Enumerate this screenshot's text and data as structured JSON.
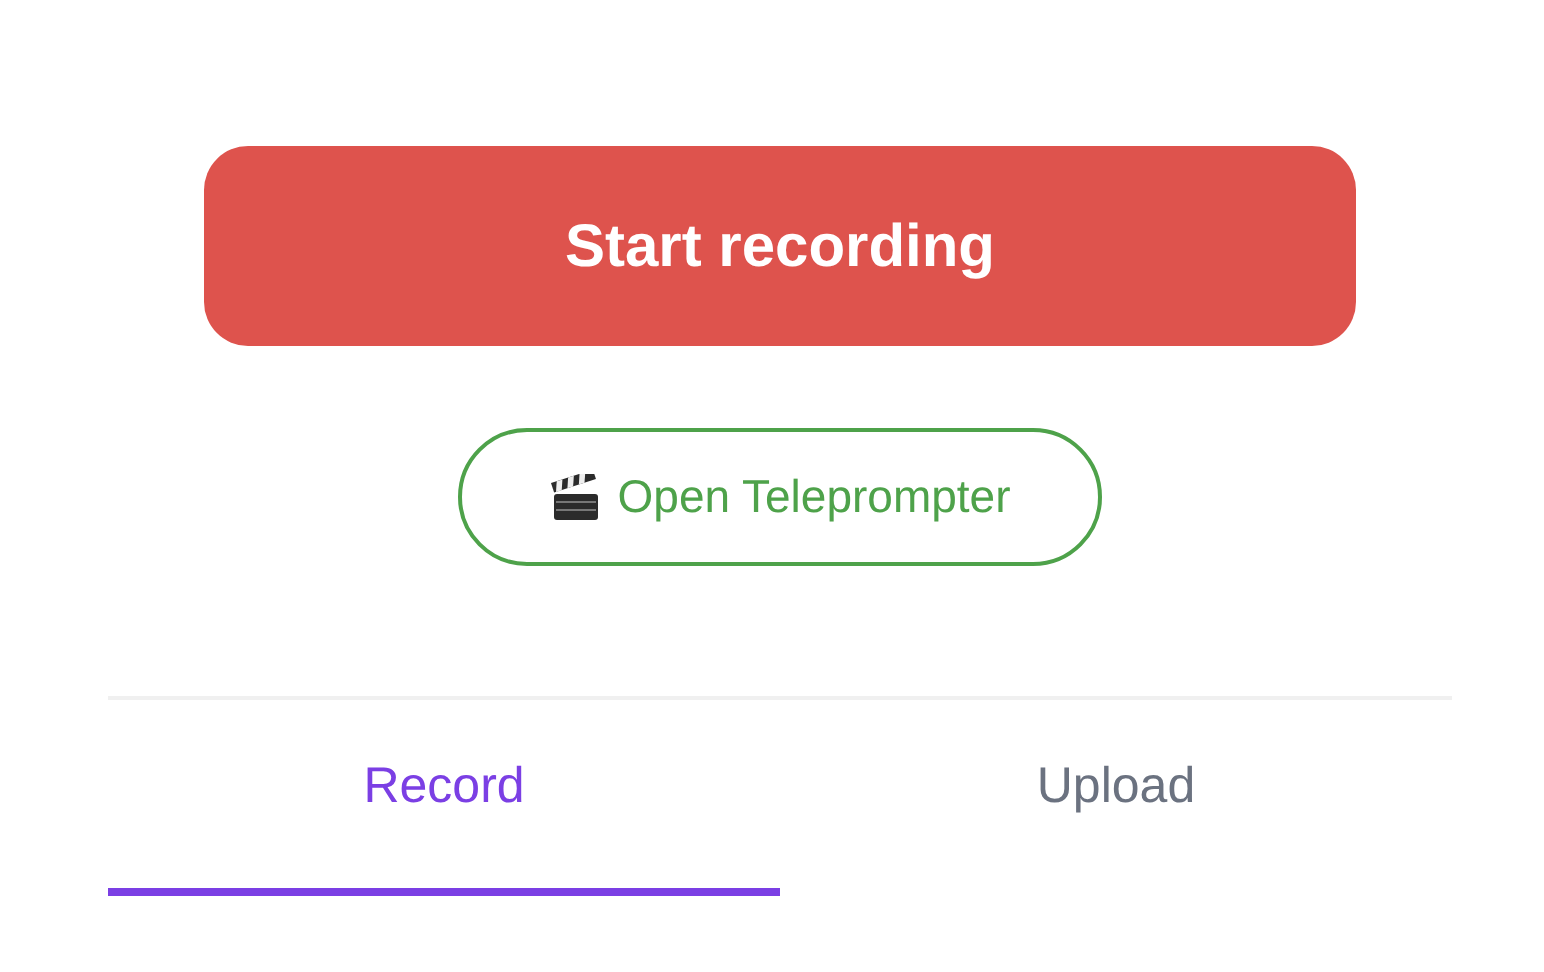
{
  "record_button": {
    "label": "Start recording"
  },
  "teleprompter_button": {
    "label": "Open Teleprompter"
  },
  "tabs": [
    {
      "label": "Record",
      "selected": true
    },
    {
      "label": "Upload",
      "selected": false
    }
  ]
}
